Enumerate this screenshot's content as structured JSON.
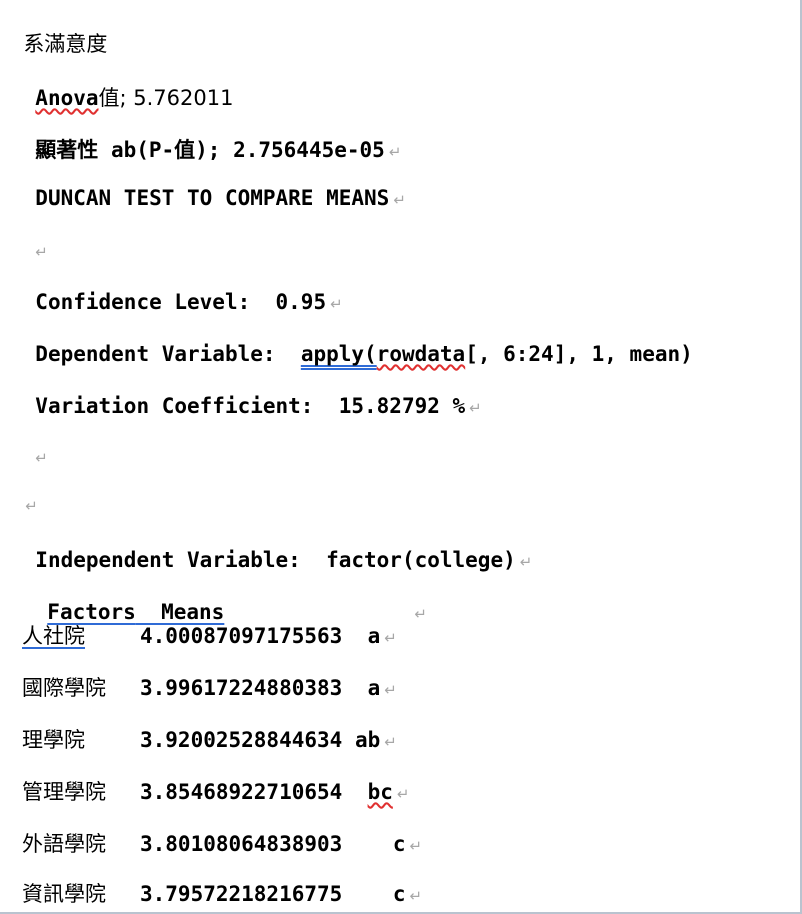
{
  "doc": {
    "line1": "系滿意度",
    "line2_a": "Anova",
    "line2_b": "值; 5.762011",
    "line3": "顯著性 ab(P-值); 2.756445e-05",
    "line4": "DUNCAN TEST TO COMPARE MEANS",
    "line6": "Confidence Level:  0.95",
    "line7_a": "Dependent Variable:  ",
    "line7_b": "apply(",
    "line7_c": "rowdata",
    "line7_d": "[, 6:24], 1, mean)",
    "line8": "Variation Coefficient:  15.82792 %",
    "line11": "Independent Variable:  factor(college)",
    "table_header_a": "Factors",
    "table_header_b": "  Means",
    "rows": [
      {
        "name": "人社院",
        "value": "4.00087097175563",
        "group": "a"
      },
      {
        "name": "國際學院",
        "value": "3.99617224880383",
        "group": "a"
      },
      {
        "name": "理學院",
        "value": "3.92002528844634",
        "group": "ab"
      },
      {
        "name": "管理學院",
        "value": "3.85468922710654",
        "group": "bc"
      },
      {
        "name": "外語學院",
        "value": "3.80108064838903",
        "group": "c"
      },
      {
        "name": "資訊學院",
        "value": "3.79572218216775",
        "group": "c"
      }
    ],
    "paragraph_mark": "↵"
  }
}
